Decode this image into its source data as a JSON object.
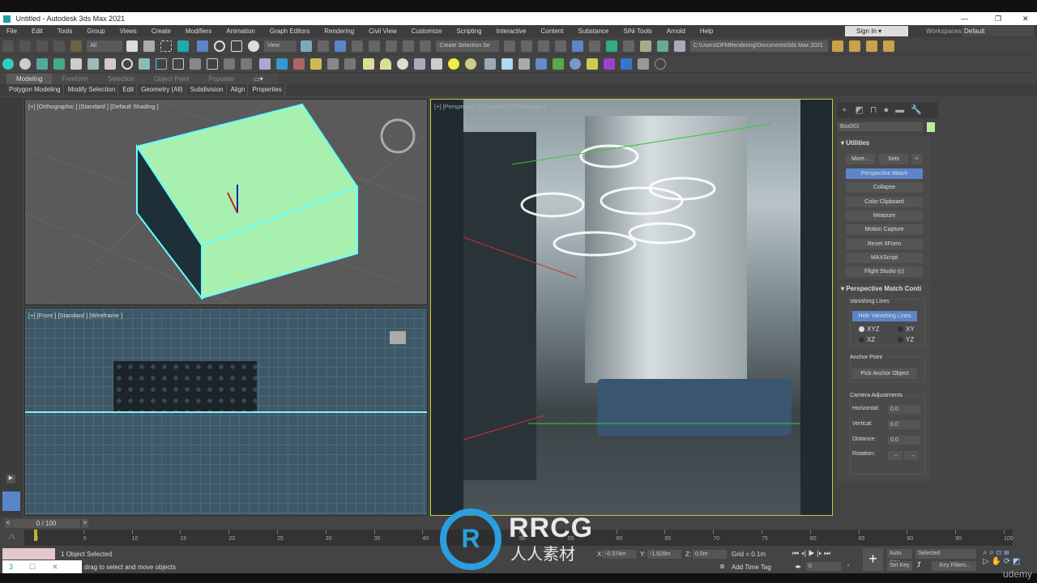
{
  "window": {
    "title": "Untitled - Autodesk 3ds Max 2021",
    "app_icon": "3ds-max-icon"
  },
  "menu": [
    "File",
    "Edit",
    "Tools",
    "Group",
    "Views",
    "Create",
    "Modifiers",
    "Animation",
    "Graph Editors",
    "Rendering",
    "Civil View",
    "Customize",
    "Scripting",
    "Interactive",
    "Content",
    "Substance",
    "SiNi Tools",
    "Arnold",
    "Help"
  ],
  "account": {
    "sign_in": "Sign In",
    "workspaces_label": "Workspaces:",
    "workspace": "Default"
  },
  "toolbar": {
    "selection_filter": "All",
    "ref_coord": "View",
    "named_selection": "Create Selection Se",
    "project_path": "C:\\Users\\DFMRendering\\Documents\\3ds Max 2021"
  },
  "ribbon": {
    "tabs": [
      "Modeling",
      "Freeform",
      "Selection",
      "Object Paint",
      "Populate"
    ],
    "active_tab": "Modeling",
    "panels": [
      "Polygon Modeling",
      "Modify Selection",
      "Edit",
      "Geometry (All)",
      "Subdivision",
      "Align",
      "Properties"
    ]
  },
  "viewports": {
    "ortho": "[+] [Orthographic ] [Standard ] [Default Shading ]",
    "front": "[+] [Front ] [Standard ] [Wireframe ]",
    "persp": "[+] [Perspective ] [Standard ] [Wireframe ]"
  },
  "colors": {
    "selection": "#a8f0b0",
    "active_vp_border": "#c8cc30",
    "highlight_button": "#5b85c9"
  },
  "command_panel": {
    "object_name": "Box001",
    "object_color": "#b8f09a",
    "utilities": {
      "title": "Utilities",
      "more": "More...",
      "sets": "Sets",
      "buttons": [
        "Perspective Match",
        "Collapse",
        "Color Clipboard",
        "Measure",
        "Motion Capture",
        "Reset XForm",
        "MAXScript",
        "Flight Studio (c)"
      ],
      "active": "Perspective Match"
    },
    "pm": {
      "title": "Perspective Match Conti",
      "vanishing_title": "Vanishing Lines",
      "hide_button": "Hide Vanishing Lines",
      "radios": [
        "XYZ",
        "XY",
        "XZ",
        "YZ"
      ],
      "selected_radio": "XYZ",
      "anchor_title": "Anchor Point",
      "pick_anchor": "Pick Anchor Object",
      "cam_title": "Camera Adjustments",
      "horizontal_label": "Horizontal:",
      "horizontal": "0.0",
      "vertical_label": "Vertical:",
      "vertical": "0.0",
      "distance_label": "Distance:",
      "distance": "0.0",
      "rotation_label": "Rotation:"
    }
  },
  "timeline": {
    "frame": "0 / 100",
    "ticks": [
      "0",
      "5",
      "10",
      "15",
      "20",
      "25",
      "30",
      "35",
      "40",
      "45",
      "50",
      "55",
      "60",
      "65",
      "70",
      "75",
      "80",
      "85",
      "90",
      "95",
      "100"
    ]
  },
  "status": {
    "selected": "1 Object Selected",
    "prompt": "drag to select and move objects",
    "x_label": "X:",
    "x": "-0.374m",
    "y_label": "Y:",
    "y": "-1.528m",
    "z_label": "Z:",
    "z": "0.0m",
    "grid": "Grid = 0.1m",
    "add_time_tag": "Add Time Tag",
    "current_frame": "0",
    "auto_key": "Auto Key",
    "set_key": "Set Key",
    "key_mode": "Selected",
    "key_filters": "Key Filters..."
  },
  "watermark": {
    "brand": "RRCG",
    "sub": "人人素材",
    "udemy": "udemy"
  }
}
